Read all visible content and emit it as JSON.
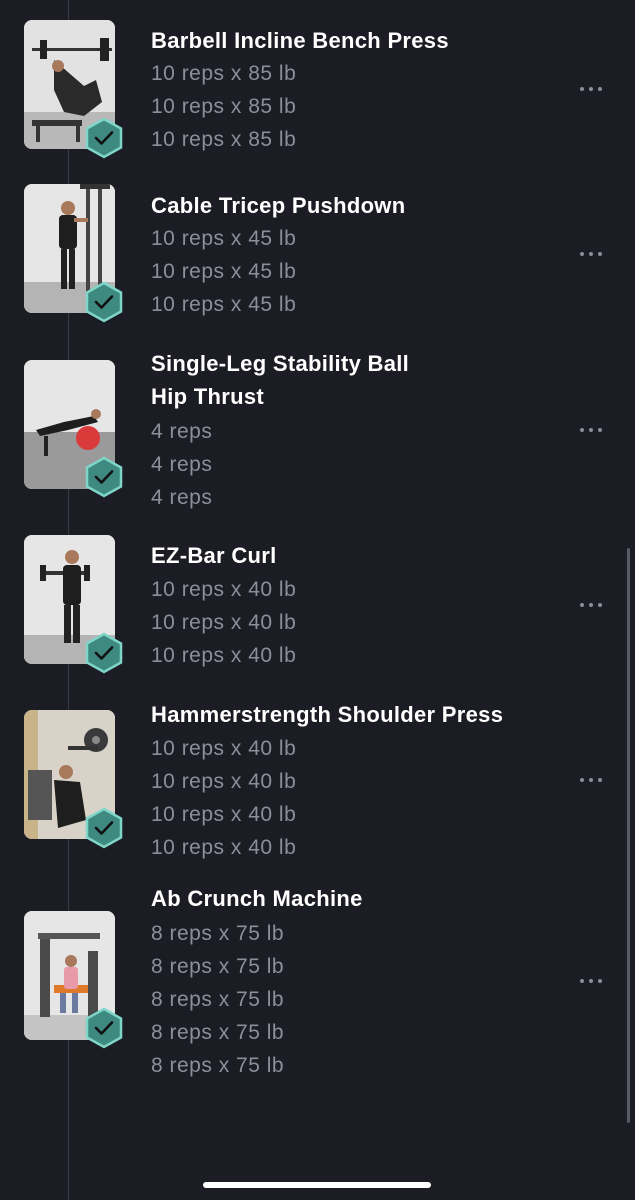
{
  "exercises": [
    {
      "name": "Barbell Incline Bench Press",
      "sets": [
        "10 reps x 85 lb",
        "10 reps x 85 lb",
        "10 reps x 85 lb"
      ],
      "completed": true
    },
    {
      "name": "Cable Tricep Pushdown",
      "sets": [
        "10 reps x 45 lb",
        "10 reps x 45 lb",
        "10 reps x 45 lb"
      ],
      "completed": true
    },
    {
      "name_lines": [
        "Single-Leg Stability Ball",
        "Hip Thrust"
      ],
      "sets": [
        "4 reps",
        "4 reps",
        "4 reps"
      ],
      "completed": true
    },
    {
      "name": "EZ-Bar Curl",
      "sets": [
        "10 reps x 40 lb",
        "10 reps x 40 lb",
        "10 reps x 40 lb"
      ],
      "completed": true
    },
    {
      "name": "Hammerstrength Shoulder Press",
      "sets": [
        "10 reps x 40 lb",
        "10 reps x 40 lb",
        "10 reps x 40 lb",
        "10 reps x 40 lb"
      ],
      "completed": true
    },
    {
      "name": "Ab Crunch Machine",
      "sets": [
        "8 reps x 75 lb",
        "8 reps x 75 lb",
        "8 reps x 75 lb",
        "8 reps x 75 lb",
        "8 reps x 75 lb"
      ],
      "completed": true
    }
  ],
  "icons": {
    "check_badge": "hexagon-check-icon",
    "more": "more-horizontal-icon"
  },
  "colors": {
    "background": "#1c1c24",
    "title": "#ffffff",
    "set_text": "#8e8e98",
    "badge_fill": "#3e8a80",
    "badge_border": "#7fd6c8"
  }
}
